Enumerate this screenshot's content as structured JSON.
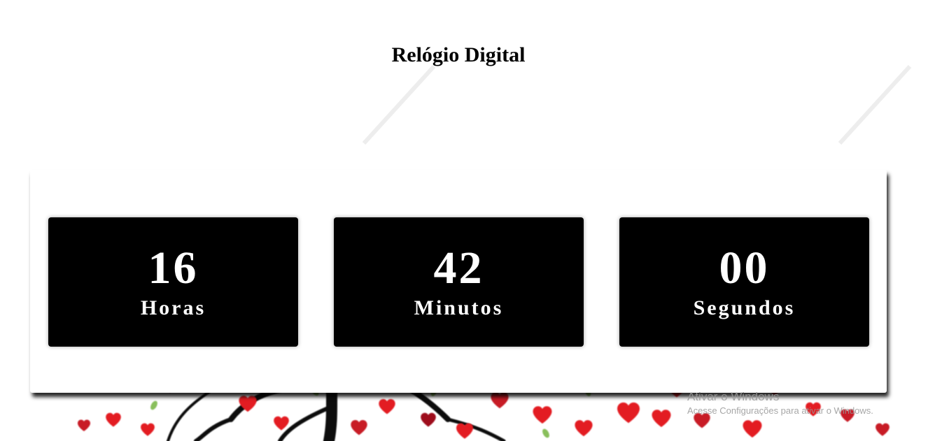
{
  "page": {
    "title": "Relógio Digital"
  },
  "clock": {
    "hours": {
      "value": "16",
      "label": "Horas"
    },
    "minutes": {
      "value": "42",
      "label": "Minutos"
    },
    "seconds": {
      "value": "00",
      "label": "Segundos"
    }
  },
  "windows_activation": {
    "title": "Ativar o Windows",
    "subtitle": "Acesse Configurações para ativar o Windows."
  },
  "colors": {
    "box_background": "#000000",
    "box_text": "#ffffff",
    "heart_red": "#e31b23",
    "heart_dark": "#9e0f1b",
    "leaf_green": "#7cb84a"
  },
  "background_image": "tree-with-hearts"
}
